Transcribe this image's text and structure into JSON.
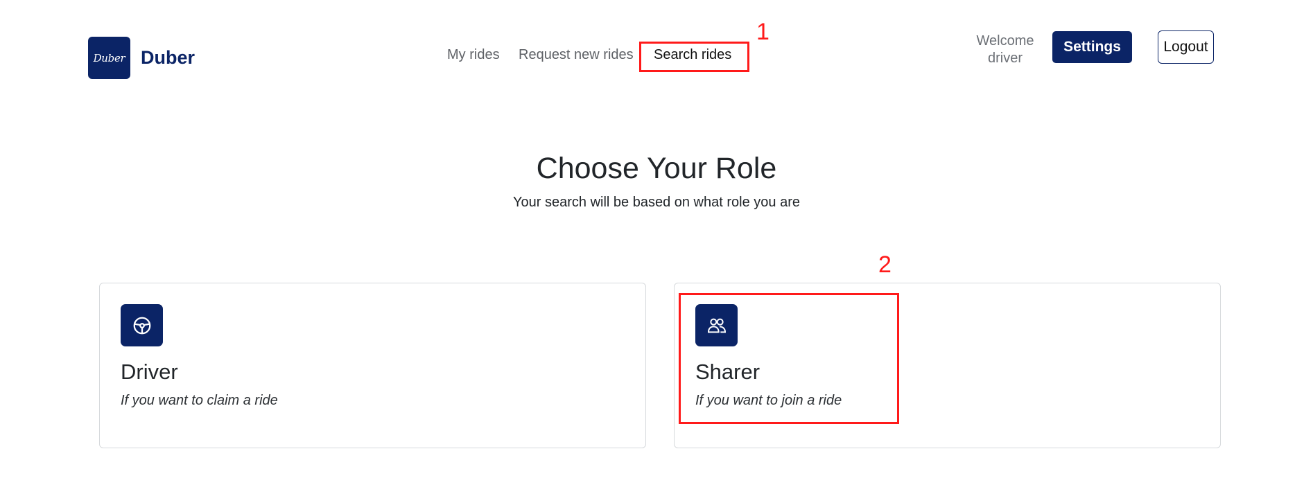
{
  "brand": {
    "logo_text": "Duber",
    "name": "Duber"
  },
  "nav": {
    "my_rides": "My rides",
    "request_new_rides": "Request new rides",
    "search_rides": "Search rides"
  },
  "header": {
    "welcome_line1": "Welcome",
    "welcome_line2": "driver",
    "settings_label": "Settings",
    "logout_label": "Logout"
  },
  "hero": {
    "title": "Choose Your Role",
    "subtitle": "Your search will be based on what role you are"
  },
  "roles": [
    {
      "icon": "steering-wheel-icon",
      "title": "Driver",
      "description": "If you want to claim a ride"
    },
    {
      "icon": "people-icon",
      "title": "Sharer",
      "description": "If you want to join a ride"
    }
  ],
  "annotations": [
    {
      "number": "1"
    },
    {
      "number": "2"
    }
  ],
  "colors": {
    "brand": "#0b2466",
    "annotation": "#ff1a1a"
  }
}
